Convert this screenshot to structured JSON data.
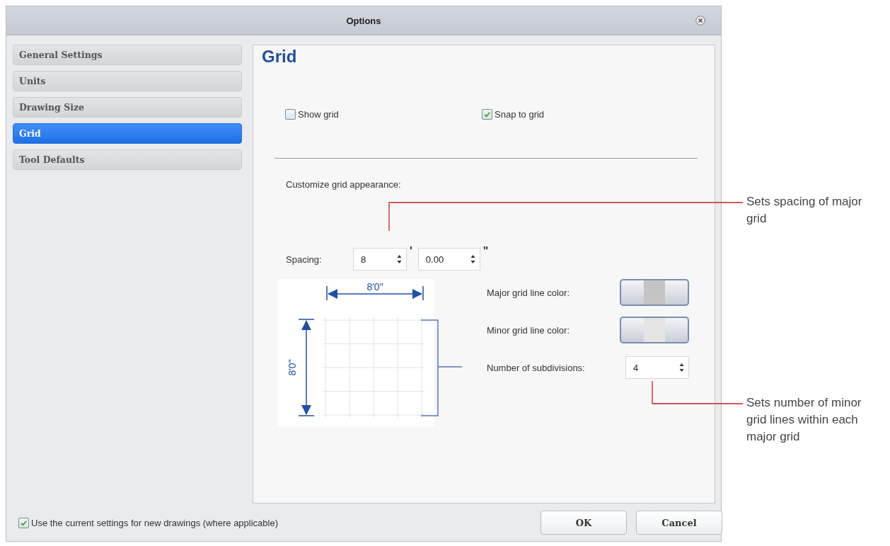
{
  "window": {
    "title": "Options"
  },
  "sidebar": {
    "items": [
      {
        "label": "General Settings",
        "selected": false
      },
      {
        "label": "Units",
        "selected": false
      },
      {
        "label": "Drawing Size",
        "selected": false
      },
      {
        "label": "Grid",
        "selected": true
      },
      {
        "label": "Tool Defaults",
        "selected": false
      }
    ]
  },
  "panel": {
    "heading": "Grid",
    "checkboxes": [
      {
        "label": "Show grid",
        "checked": false
      },
      {
        "label": "Snap to grid",
        "checked": true
      }
    ],
    "section_label": "Customize grid appearance:",
    "spacing": {
      "label": "Spacing:",
      "feet": "8",
      "feet_unit": "'",
      "inches": "0.00",
      "inches_unit": "\""
    },
    "preview": {
      "width_label": "8'0\"",
      "height_label": "8'0\""
    },
    "color_rows": [
      {
        "label": "Major grid line color:",
        "color": "#c4c4c4"
      },
      {
        "label": "Minor grid line color:",
        "color": "#e4e4e4"
      }
    ],
    "subdivisions": {
      "label": "Number of subdivisions:",
      "value": "4"
    }
  },
  "footer": {
    "checkbox": {
      "label": "Use the current settings for new drawings (where applicable)",
      "checked": true
    },
    "buttons": [
      "OK",
      "Cancel"
    ]
  },
  "callouts": [
    "Sets spacing of major grid",
    "Sets number of minor grid lines within each major grid"
  ]
}
